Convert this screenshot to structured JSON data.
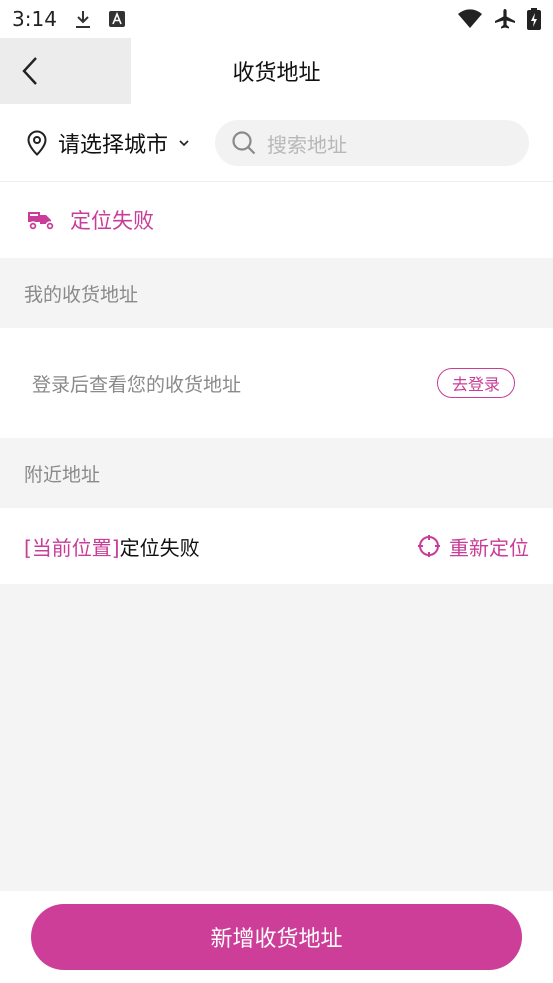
{
  "status_bar": {
    "time": "3:14"
  },
  "header": {
    "title": "收货地址"
  },
  "search": {
    "city_label": "请选择城市",
    "placeholder": "搜索地址"
  },
  "location": {
    "status": "定位失败"
  },
  "my_addresses": {
    "title": "我的收货地址",
    "login_hint": "登录后查看您的收货地址",
    "login_button": "去登录"
  },
  "nearby": {
    "title": "附近地址",
    "current_tag": "[当前位置]",
    "current_status": "定位失败",
    "relocate_label": "重新定位"
  },
  "footer": {
    "add_button": "新增收货地址"
  },
  "colors": {
    "accent": "#cd3e98",
    "section_bg": "#f4f4f4"
  }
}
